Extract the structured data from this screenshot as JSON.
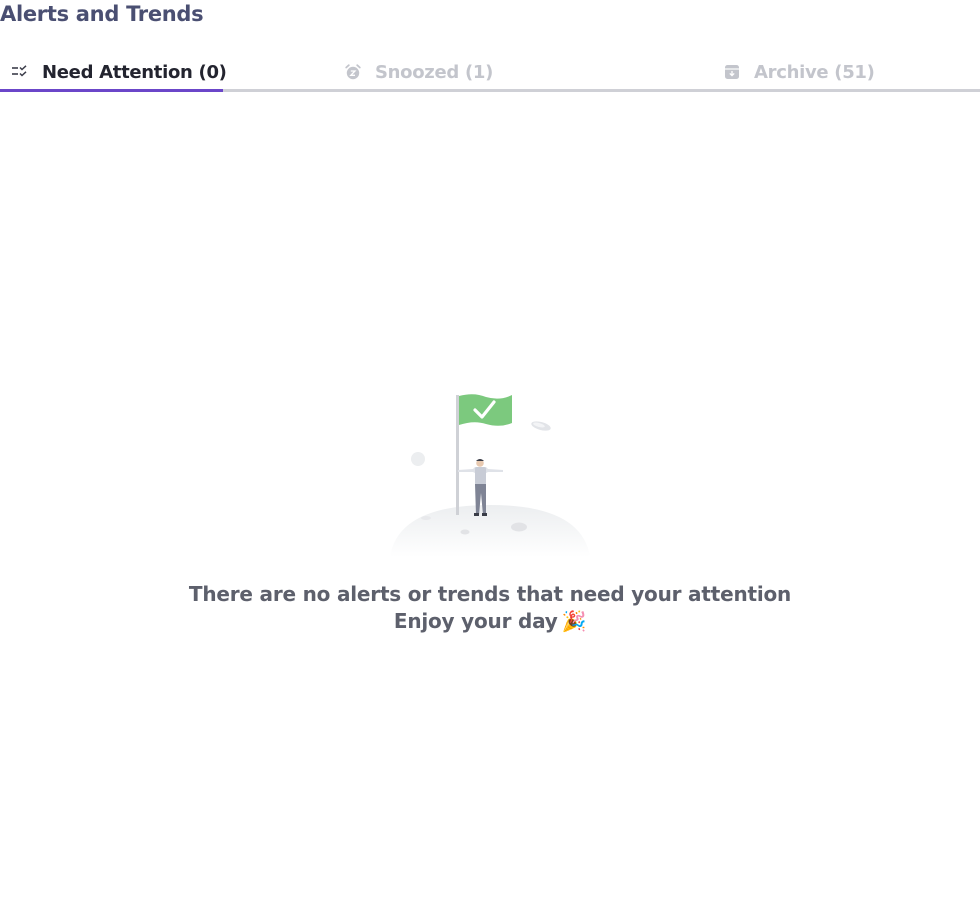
{
  "page": {
    "title": "Alerts and Trends"
  },
  "tabs": [
    {
      "label": "Need Attention (0)",
      "icon": "checklist-icon",
      "active": true
    },
    {
      "label": "Snoozed (1)",
      "icon": "alarm-clock-icon",
      "active": false
    },
    {
      "label": "Archive (51)",
      "icon": "archive-box-icon",
      "active": false
    }
  ],
  "empty_state": {
    "message": "There are no alerts or trends that need your attention",
    "submessage": "Enjoy your day",
    "emoji": "🎉",
    "illustration": "person-with-flag-on-hill-illustration"
  },
  "colors": {
    "title": "#4a4f72",
    "tab_active_text": "#23242f",
    "tab_inactive_text": "#c3c5cc",
    "tab_underline": "#6b46c9",
    "tab_baseline": "#cfd0d6",
    "flag_green": "#7cc97e",
    "message_text": "#5d606c"
  }
}
